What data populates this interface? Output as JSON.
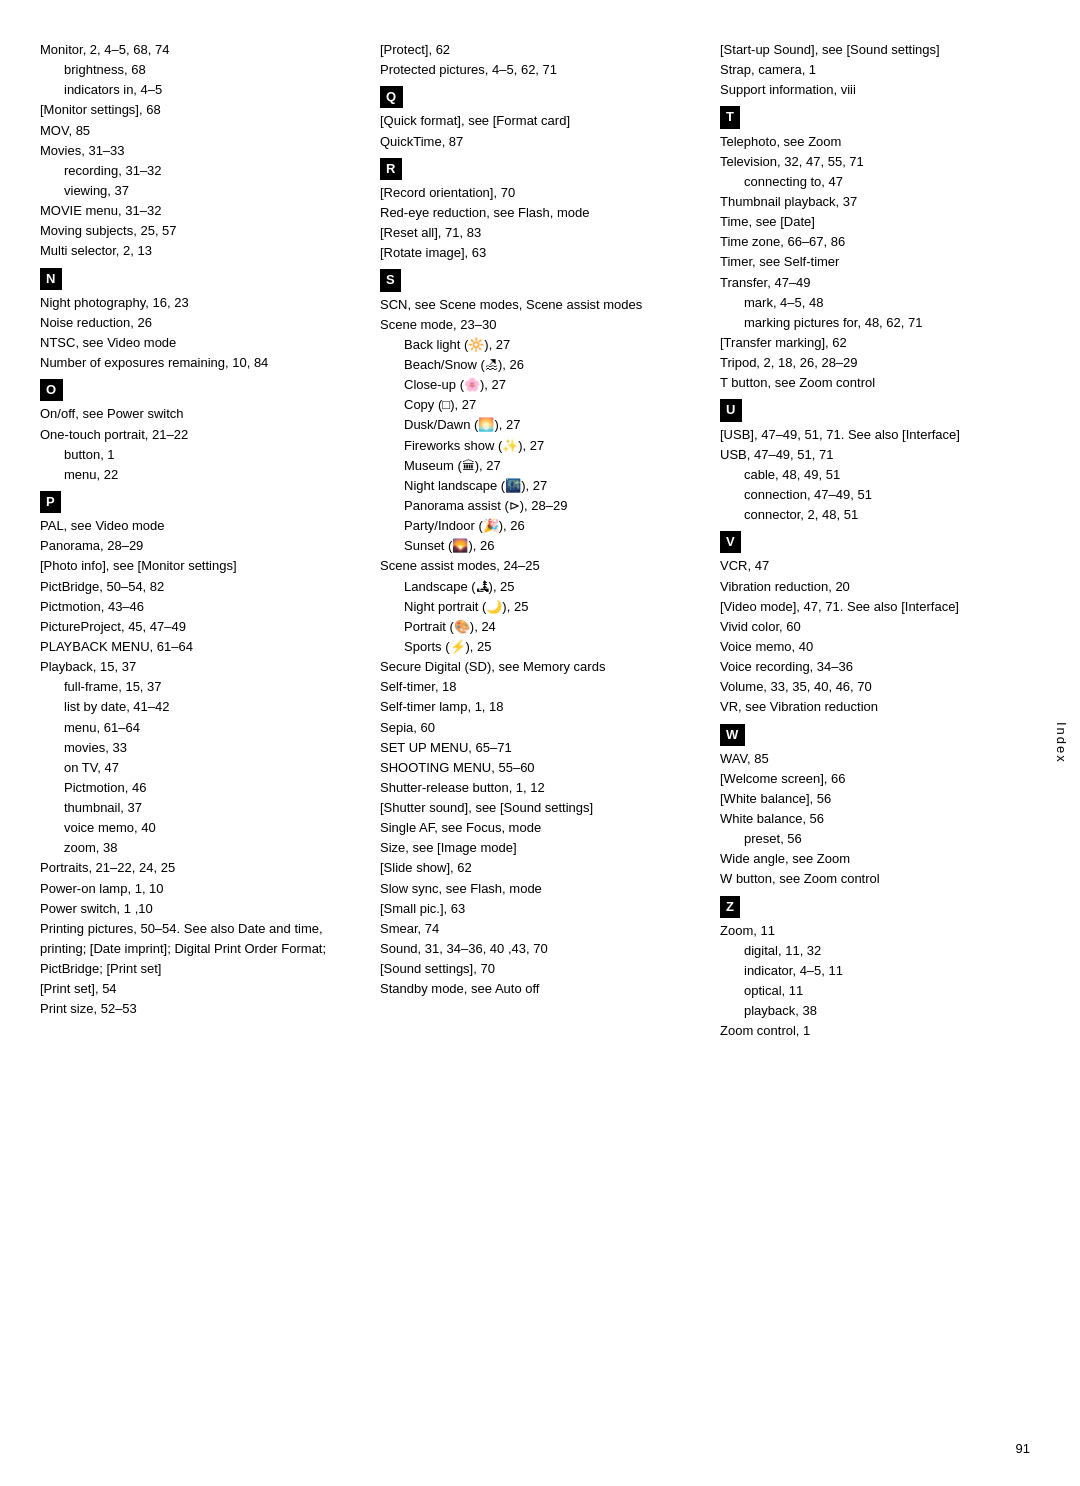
{
  "page": {
    "number": "91",
    "index_label": "Index"
  },
  "columns": [
    {
      "id": "col1",
      "entries": [
        {
          "text": "Monitor, 2, 4–5, 68, 74",
          "level": 0
        },
        {
          "text": "brightness, 68",
          "level": 1
        },
        {
          "text": "indicators in, 4–5",
          "level": 1
        },
        {
          "text": "[Monitor settings], 68",
          "level": 0
        },
        {
          "text": "MOV, 85",
          "level": 0
        },
        {
          "text": "Movies, 31–33",
          "level": 0
        },
        {
          "text": "recording, 31–32",
          "level": 1
        },
        {
          "text": "viewing, 37",
          "level": 1
        },
        {
          "text": "MOVIE menu, 31–32",
          "level": 0
        },
        {
          "text": "Moving subjects, 25, 57",
          "level": 0
        },
        {
          "text": "Multi selector, 2, 13",
          "level": 0
        },
        {
          "section": "N"
        },
        {
          "text": "Night photography, 16, 23",
          "level": 0
        },
        {
          "text": "Noise reduction, 26",
          "level": 0
        },
        {
          "text": "NTSC, see Video mode",
          "level": 0
        },
        {
          "text": "Number of exposures remaining, 10, 84",
          "level": 0
        },
        {
          "section": "O"
        },
        {
          "text": "On/off, see Power switch",
          "level": 0
        },
        {
          "text": "One-touch portrait, 21–22",
          "level": 0
        },
        {
          "text": "button, 1",
          "level": 1
        },
        {
          "text": "menu, 22",
          "level": 1
        },
        {
          "section": "P"
        },
        {
          "text": "PAL, see Video mode",
          "level": 0
        },
        {
          "text": "Panorama, 28–29",
          "level": 0
        },
        {
          "text": "[Photo info], see [Monitor settings]",
          "level": 0
        },
        {
          "text": "PictBridge, 50–54, 82",
          "level": 0
        },
        {
          "text": "Pictmotion, 43–46",
          "level": 0
        },
        {
          "text": "PictureProject, 45, 47–49",
          "level": 0
        },
        {
          "text": "PLAYBACK MENU, 61–64",
          "level": 0
        },
        {
          "text": "Playback, 15, 37",
          "level": 0
        },
        {
          "text": "full-frame, 15, 37",
          "level": 1
        },
        {
          "text": "list by date, 41–42",
          "level": 1
        },
        {
          "text": "menu, 61–64",
          "level": 1
        },
        {
          "text": "movies, 33",
          "level": 1
        },
        {
          "text": "on TV, 47",
          "level": 1
        },
        {
          "text": "Pictmotion, 46",
          "level": 1
        },
        {
          "text": "thumbnail, 37",
          "level": 1
        },
        {
          "text": "voice memo, 40",
          "level": 1
        },
        {
          "text": "zoom, 38",
          "level": 1
        },
        {
          "text": "Portraits, 21–22, 24, 25",
          "level": 0
        },
        {
          "text": "Power-on lamp, 1, 10",
          "level": 0
        },
        {
          "text": "Power switch, 1 ,10",
          "level": 0
        },
        {
          "text": "Printing pictures, 50–54. See also Date and time, printing; [Date imprint]; Digital Print Order Format; PictBridge; [Print set]",
          "level": 0
        },
        {
          "text": "[Print set], 54",
          "level": 0
        },
        {
          "text": "Print size, 52–53",
          "level": 0
        }
      ]
    },
    {
      "id": "col2",
      "entries": [
        {
          "text": "[Protect], 62",
          "level": 0
        },
        {
          "text": "Protected pictures, 4–5, 62, 71",
          "level": 0
        },
        {
          "section": "Q"
        },
        {
          "text": "[Quick format], see [Format card]",
          "level": 0
        },
        {
          "text": "QuickTime, 87",
          "level": 0
        },
        {
          "section": "R"
        },
        {
          "text": "[Record orientation], 70",
          "level": 0
        },
        {
          "text": "Red-eye reduction, see Flash, mode",
          "level": 0
        },
        {
          "text": "[Reset all], 71, 83",
          "level": 0
        },
        {
          "text": "[Rotate image], 63",
          "level": 0
        },
        {
          "section": "S"
        },
        {
          "text": "SCN, see Scene modes, Scene assist modes",
          "level": 0
        },
        {
          "text": "Scene mode, 23–30",
          "level": 0
        },
        {
          "text": "Back light (🔆), 27",
          "level": 1
        },
        {
          "text": "Beach/Snow (🏖), 26",
          "level": 1
        },
        {
          "text": "Close-up (🌸), 27",
          "level": 1
        },
        {
          "text": "Copy (□), 27",
          "level": 1
        },
        {
          "text": "Dusk/Dawn (🌅), 27",
          "level": 1
        },
        {
          "text": "Fireworks show (✨), 27",
          "level": 1
        },
        {
          "text": "Museum (🏛), 27",
          "level": 1
        },
        {
          "text": "Night landscape (🌃), 27",
          "level": 1
        },
        {
          "text": "Panorama assist (⊳), 28–29",
          "level": 1
        },
        {
          "text": "Party/Indoor (🎉), 26",
          "level": 1
        },
        {
          "text": "Sunset (🌄), 26",
          "level": 1
        },
        {
          "text": "Scene assist modes, 24–25",
          "level": 0
        },
        {
          "text": "Landscape (🏞), 25",
          "level": 1
        },
        {
          "text": "Night portrait (🌙), 25",
          "level": 1
        },
        {
          "text": "Portrait (🎨), 24",
          "level": 1
        },
        {
          "text": "Sports (⚡), 25",
          "level": 1
        },
        {
          "text": "Secure Digital (SD), see Memory cards",
          "level": 0
        },
        {
          "text": "Self-timer, 18",
          "level": 0
        },
        {
          "text": "Self-timer lamp, 1, 18",
          "level": 0
        },
        {
          "text": "Sepia, 60",
          "level": 0
        },
        {
          "text": "SET UP MENU, 65–71",
          "level": 0
        },
        {
          "text": "SHOOTING MENU, 55–60",
          "level": 0
        },
        {
          "text": "Shutter-release button, 1, 12",
          "level": 0
        },
        {
          "text": "[Shutter sound], see [Sound settings]",
          "level": 0
        },
        {
          "text": "Single AF, see Focus, mode",
          "level": 0
        },
        {
          "text": "Size, see [Image mode]",
          "level": 0
        },
        {
          "text": "[Slide show], 62",
          "level": 0
        },
        {
          "text": "Slow sync, see Flash, mode",
          "level": 0
        },
        {
          "text": "[Small pic.], 63",
          "level": 0
        },
        {
          "text": "Smear, 74",
          "level": 0
        },
        {
          "text": "Sound, 31, 34–36, 40 ,43, 70",
          "level": 0
        },
        {
          "text": "[Sound settings], 70",
          "level": 0
        },
        {
          "text": "Standby mode, see Auto off",
          "level": 0
        }
      ]
    },
    {
      "id": "col3",
      "entries": [
        {
          "text": "[Start-up Sound], see [Sound settings]",
          "level": 0
        },
        {
          "text": "Strap, camera, 1",
          "level": 0
        },
        {
          "text": "Support information, viii",
          "level": 0
        },
        {
          "section": "T"
        },
        {
          "text": "Telephoto, see Zoom",
          "level": 0
        },
        {
          "text": "Television, 32, 47, 55, 71",
          "level": 0
        },
        {
          "text": "connecting to, 47",
          "level": 1
        },
        {
          "text": "Thumbnail playback, 37",
          "level": 0
        },
        {
          "text": "Time, see [Date]",
          "level": 0
        },
        {
          "text": "Time zone, 66–67, 86",
          "level": 0
        },
        {
          "text": "Timer, see Self-timer",
          "level": 0
        },
        {
          "text": "Transfer, 47–49",
          "level": 0
        },
        {
          "text": "mark, 4–5, 48",
          "level": 1
        },
        {
          "text": "marking pictures for, 48, 62, 71",
          "level": 1
        },
        {
          "text": "[Transfer marking], 62",
          "level": 0
        },
        {
          "text": "Tripod, 2, 18, 26, 28–29",
          "level": 0
        },
        {
          "text": "T button, see Zoom control",
          "level": 0
        },
        {
          "section": "U"
        },
        {
          "text": "[USB], 47–49, 51, 71. See also [Interface]",
          "level": 0
        },
        {
          "text": "USB, 47–49, 51, 71",
          "level": 0
        },
        {
          "text": "cable, 48, 49, 51",
          "level": 1
        },
        {
          "text": "connection, 47–49, 51",
          "level": 1
        },
        {
          "text": "connector, 2, 48, 51",
          "level": 1
        },
        {
          "section": "V"
        },
        {
          "text": "VCR, 47",
          "level": 0
        },
        {
          "text": "Vibration reduction, 20",
          "level": 0
        },
        {
          "text": "[Video mode], 47, 71. See also [Interface]",
          "level": 0
        },
        {
          "text": "Vivid color, 60",
          "level": 0
        },
        {
          "text": "Voice memo, 40",
          "level": 0
        },
        {
          "text": "Voice recording, 34–36",
          "level": 0
        },
        {
          "text": "Volume, 33, 35, 40, 46, 70",
          "level": 0
        },
        {
          "text": "VR, see Vibration reduction",
          "level": 0
        },
        {
          "section": "W"
        },
        {
          "text": "WAV, 85",
          "level": 0
        },
        {
          "text": "[Welcome screen], 66",
          "level": 0
        },
        {
          "text": "[White balance], 56",
          "level": 0
        },
        {
          "text": "White balance, 56",
          "level": 0
        },
        {
          "text": "preset, 56",
          "level": 1
        },
        {
          "text": "Wide angle, see Zoom",
          "level": 0
        },
        {
          "text": "W button, see Zoom control",
          "level": 0
        },
        {
          "section": "Z"
        },
        {
          "text": "Zoom, 11",
          "level": 0
        },
        {
          "text": "digital, 11, 32",
          "level": 1
        },
        {
          "text": "indicator, 4–5, 11",
          "level": 1
        },
        {
          "text": "optical, 11",
          "level": 1
        },
        {
          "text": "playback, 38",
          "level": 1
        },
        {
          "text": "Zoom control, 1",
          "level": 0
        }
      ]
    }
  ]
}
